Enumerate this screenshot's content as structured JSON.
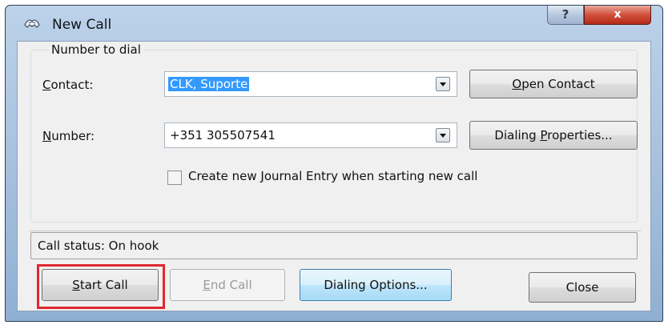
{
  "window": {
    "title": "New Call",
    "help_glyph": "?",
    "close_glyph": "x"
  },
  "group": {
    "legend": "Number to dial"
  },
  "contact": {
    "label_accel": "C",
    "label_rest": "ontact:",
    "value": "CLK, Suporte",
    "open_button_accel": "O",
    "open_button_rest": "pen Contact"
  },
  "number": {
    "label_accel": "N",
    "label_rest": "umber:",
    "value": "+351 305507541",
    "dialing_props_before": "Dialing ",
    "dialing_props_accel": "P",
    "dialing_props_after": "roperties..."
  },
  "journal": {
    "checked": false,
    "label_before": "Create new ",
    "label_accel": "J",
    "label_after": "ournal Entry when starting new call"
  },
  "status": {
    "text": "Call status: On hook"
  },
  "buttons": {
    "start_accel": "S",
    "start_rest": "tart Call",
    "end_accel": "E",
    "end_rest": "nd Call",
    "dialing_options": "Dialing Options...",
    "close": "Close"
  },
  "colors": {
    "selection": "#3399ff",
    "annotation_red": "#e0272e",
    "close_button_red": "#c43b27"
  }
}
